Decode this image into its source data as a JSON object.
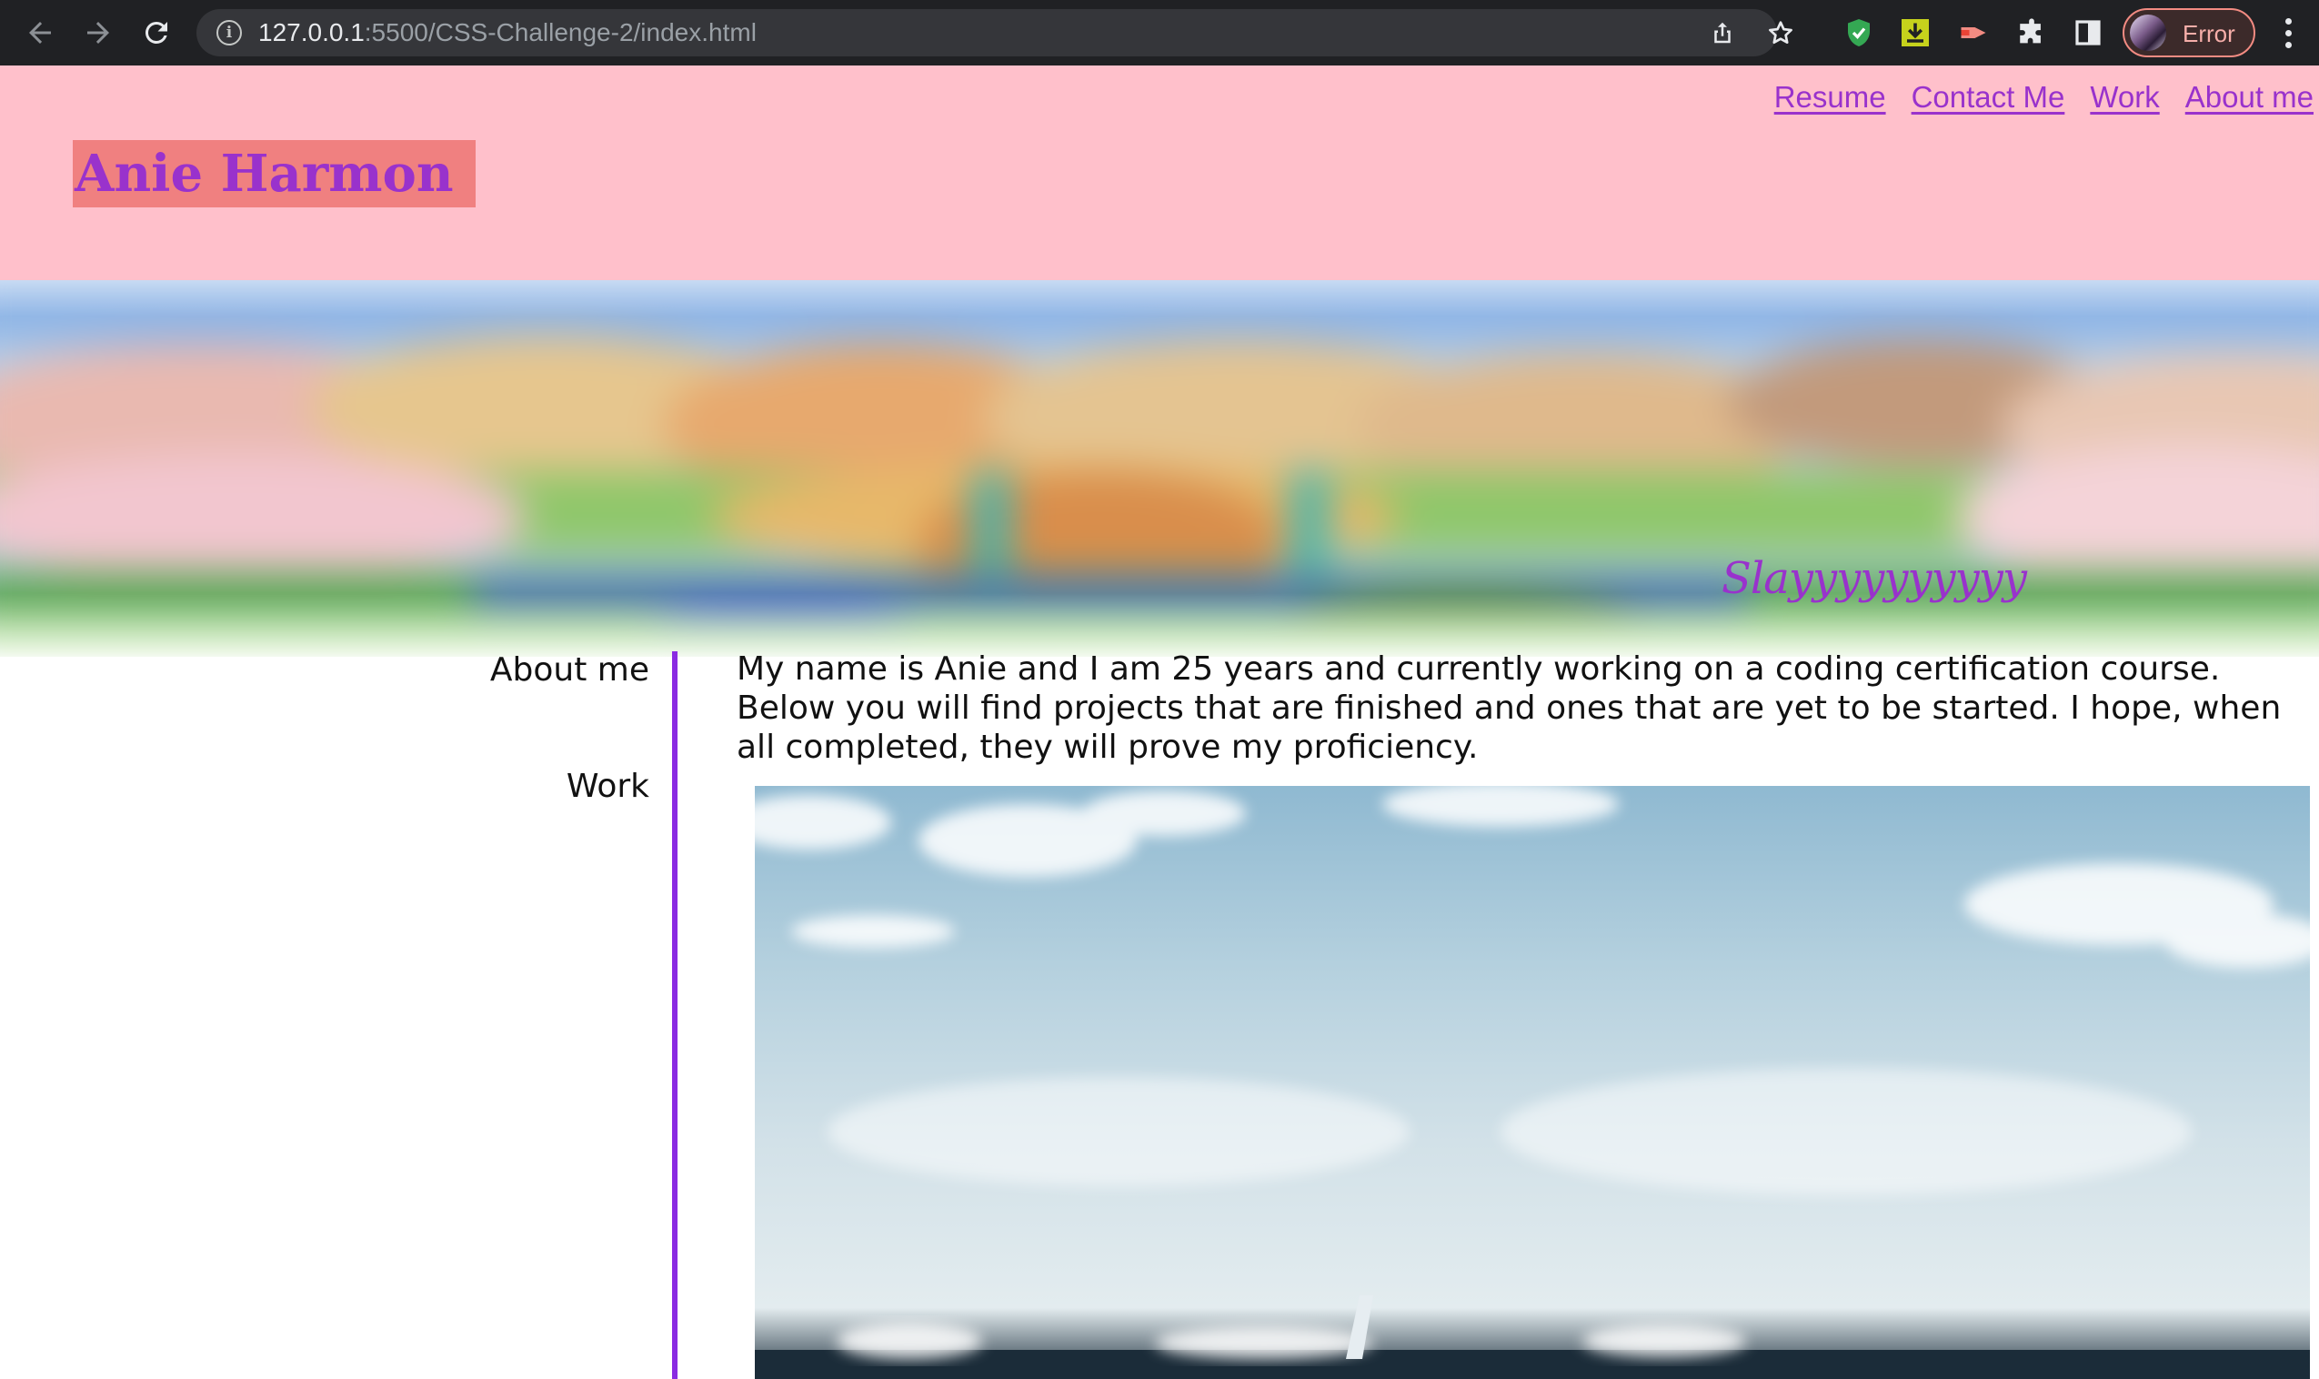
{
  "browser": {
    "url_host": "127.0.0.1",
    "url_rest": ":5500/CSS-Challenge-2/index.html",
    "profile_label": "Error",
    "icons": [
      "back-icon",
      "forward-icon",
      "reload-icon",
      "info-icon",
      "share-icon",
      "star-icon",
      "shield-extension-icon",
      "download-extension-icon",
      "video-extension-icon",
      "puzzle-icon",
      "side-panel-icon",
      "more-menu-icon"
    ]
  },
  "header": {
    "title": "Anie Harmon",
    "nav": [
      "Resume",
      "Contact Me",
      "Work",
      "About me"
    ]
  },
  "hero": {
    "tagline": "Slayyyyyyyyyy"
  },
  "sidebar": {
    "items": [
      "About me",
      "Work"
    ]
  },
  "main": {
    "about_text": "My name is Anie and I am 25 years and currently working on a coding certification course. Below you will find projects that are finished and ones that are yet to be started. I hope, when all completed, they will prove my proficiency."
  },
  "colors": {
    "header_bg": "#ffc0cb",
    "title_bg": "#f08080",
    "accent": "#9932cc",
    "divider": "#8a2be2",
    "chrome_bg": "#202124"
  }
}
